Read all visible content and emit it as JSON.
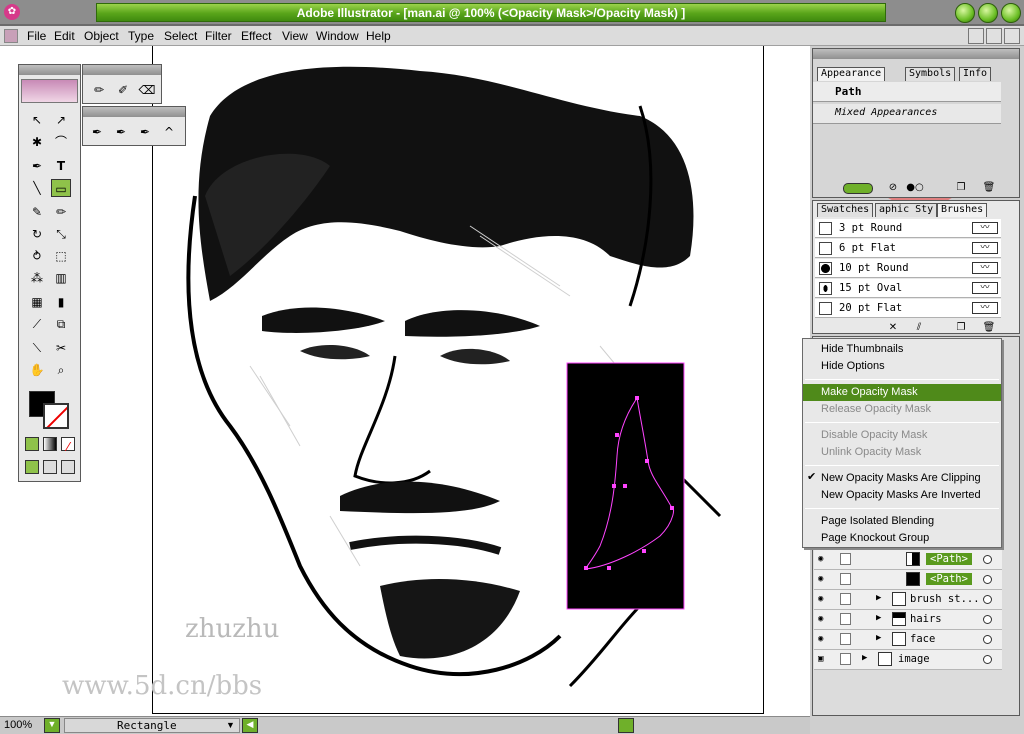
{
  "app": {
    "title": "Adobe Illustrator - [man.ai @ 100% (<Opacity Mask>/Opacity Mask) ]",
    "icon_text": "✿"
  },
  "menubar": [
    "File",
    "Edit",
    "Object",
    "Type",
    "Select",
    "Filter",
    "Effect",
    "View",
    "Window",
    "Help"
  ],
  "appearance_panel": {
    "tabs": [
      "Appearance",
      "Symbols",
      "Info"
    ],
    "object": "Path",
    "mixed": "Mixed Appearances"
  },
  "brushes_panel": {
    "tabs": [
      "Swatches",
      "aphic Sty",
      "Brushes"
    ],
    "items": [
      "3 pt Round",
      "6 pt Flat",
      "10 pt Round",
      "15 pt Oval",
      "20 pt Flat"
    ]
  },
  "context_menu": {
    "items": [
      {
        "label": "Hide Thumbnails",
        "state": "enabled"
      },
      {
        "label": "Hide Options",
        "state": "enabled"
      },
      {
        "label": "Make Opacity Mask",
        "state": "highlighted"
      },
      {
        "label": "Release Opacity Mask",
        "state": "disabled"
      },
      {
        "label": "Disable Opacity Mask",
        "state": "disabled"
      },
      {
        "label": "Unlink Opacity Mask",
        "state": "disabled"
      },
      {
        "label": "New Opacity Masks Are Clipping",
        "state": "checked"
      },
      {
        "label": "New Opacity Masks Are Inverted",
        "state": "enabled"
      },
      {
        "label": "Page Isolated Blending",
        "state": "enabled"
      },
      {
        "label": "Page Knockout Group",
        "state": "enabled"
      }
    ]
  },
  "layers": [
    {
      "name": "<Path>",
      "selected": true
    },
    {
      "name": "<Path>",
      "selected": true
    },
    {
      "name": "brush st...",
      "selected": false
    },
    {
      "name": "hairs",
      "selected": false
    },
    {
      "name": "face",
      "selected": false
    },
    {
      "name": "image",
      "selected": false
    }
  ],
  "status": {
    "zoom": "100%",
    "tool": "Rectangle"
  },
  "watermark": {
    "line1": "zhuzhu",
    "line2": "www.5d.cn/bbs"
  },
  "colors": {
    "accent": "#5a9a1e",
    "mask_path": "#ff44ff"
  }
}
